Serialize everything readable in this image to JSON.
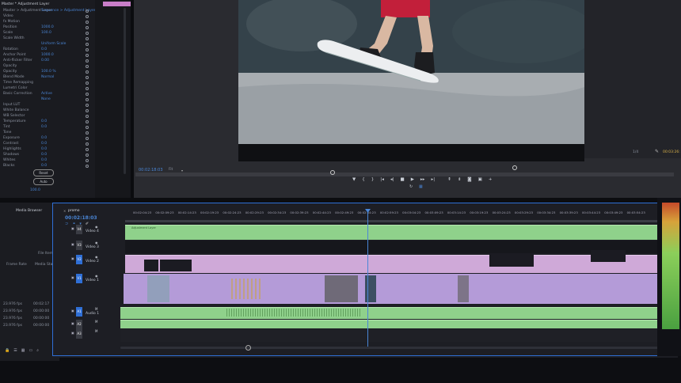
{
  "effect_controls": {
    "rows": [
      {
        "label": "Master > Adjustment Layer",
        "value": "Sequence > Adjustment Layer"
      },
      {
        "label": "Video",
        "value": ""
      },
      {
        "label": "fx Motion",
        "value": ""
      },
      {
        "label": "Position",
        "value": "1000.0"
      },
      {
        "label": "Scale",
        "value": "100.0"
      },
      {
        "label": "Scale Width",
        "value": ""
      },
      {
        "label": "",
        "value": "Uniform Scale"
      },
      {
        "label": "Rotation",
        "value": "0.0"
      },
      {
        "label": "Anchor Point",
        "value": "1000.0"
      },
      {
        "label": "Anti-flicker Filter",
        "value": "0.00"
      },
      {
        "label": "Opacity",
        "value": ""
      },
      {
        "label": "Opacity",
        "value": "100.0 %"
      },
      {
        "label": "Blend Mode",
        "value": "Normal"
      },
      {
        "label": "Time Remapping",
        "value": ""
      },
      {
        "label": "Lumetri Color",
        "value": ""
      },
      {
        "label": "Basic Correction",
        "value": "Active"
      },
      {
        "label": "",
        "value": "None"
      },
      {
        "label": "Input LUT",
        "value": ""
      },
      {
        "label": "White Balance",
        "value": ""
      },
      {
        "label": "WB Selector",
        "value": ""
      },
      {
        "label": "Temperature",
        "value": "0.0"
      },
      {
        "label": "Tint",
        "value": "0.0"
      },
      {
        "label": "Tone",
        "value": ""
      },
      {
        "label": "Exposure",
        "value": "0.0"
      },
      {
        "label": "Contrast",
        "value": "0.0"
      },
      {
        "label": "Highlights",
        "value": "0.0"
      },
      {
        "label": "Shadows",
        "value": "0.0"
      },
      {
        "label": "Whites",
        "value": "0.0"
      },
      {
        "label": "Blacks",
        "value": "0.0"
      }
    ],
    "reset_label": "Reset",
    "auto_label": "Auto",
    "saturation_value": "100.0",
    "top_tab": "Master * Adjustment Layer"
  },
  "program_monitor": {
    "timecode": "00:02:18:03",
    "fit_label": "Fit",
    "quality": "1/4",
    "duration": "00:03:26:"
  },
  "project_panel": {
    "tab": "Media Browser",
    "col1": "Frame Rate",
    "col2": "Media Start",
    "col3": "File Items",
    "rows": [
      {
        "fps": "23.976 fps",
        "start": "00:02:17"
      },
      {
        "fps": "23.976 fps",
        "start": "00:00:00"
      },
      {
        "fps": "23.976 fps",
        "start": "00:00:00"
      },
      {
        "fps": "23.976 fps",
        "start": "00:00:00"
      }
    ]
  },
  "timeline": {
    "sequence_name": "promo",
    "timecode": "00:02:18:03",
    "ruler": [
      "00:02:04:23",
      "00:02:09:23",
      "00:02:14:23",
      "00:02:19:23",
      "00:02:24:23",
      "00:02:29:23",
      "00:02:34:23",
      "00:02:39:23",
      "00:02:44:23",
      "00:02:49:23",
      "00:02:54:23",
      "00:02:59:23",
      "00:03:04:23",
      "00:03:09:23",
      "00:03:14:23",
      "00:03:19:23",
      "00:03:24:23",
      "00:03:29:23",
      "00:03:34:23",
      "00:03:39:23",
      "00:03:44:23",
      "00:03:49:23",
      "00:03:54:23"
    ],
    "tracks": [
      {
        "id": "V4",
        "name": "Video 4"
      },
      {
        "id": "V3",
        "name": "Video 3"
      },
      {
        "id": "V2",
        "name": "Video 2"
      },
      {
        "id": "V1",
        "name": "Video 1"
      },
      {
        "id": "A1",
        "name": "Audio 1"
      },
      {
        "id": "A2",
        "name": ""
      },
      {
        "id": "A3",
        "name": ""
      }
    ],
    "adjustment_clip_label": "Adjustment Layer"
  },
  "colors": {
    "accent_blue": "#2f6fd6",
    "clip_green": "#8fd18b",
    "clip_pink": "#cfa9d8",
    "clip_lavender": "#b49bd8",
    "playhead": "#4a86d6"
  }
}
